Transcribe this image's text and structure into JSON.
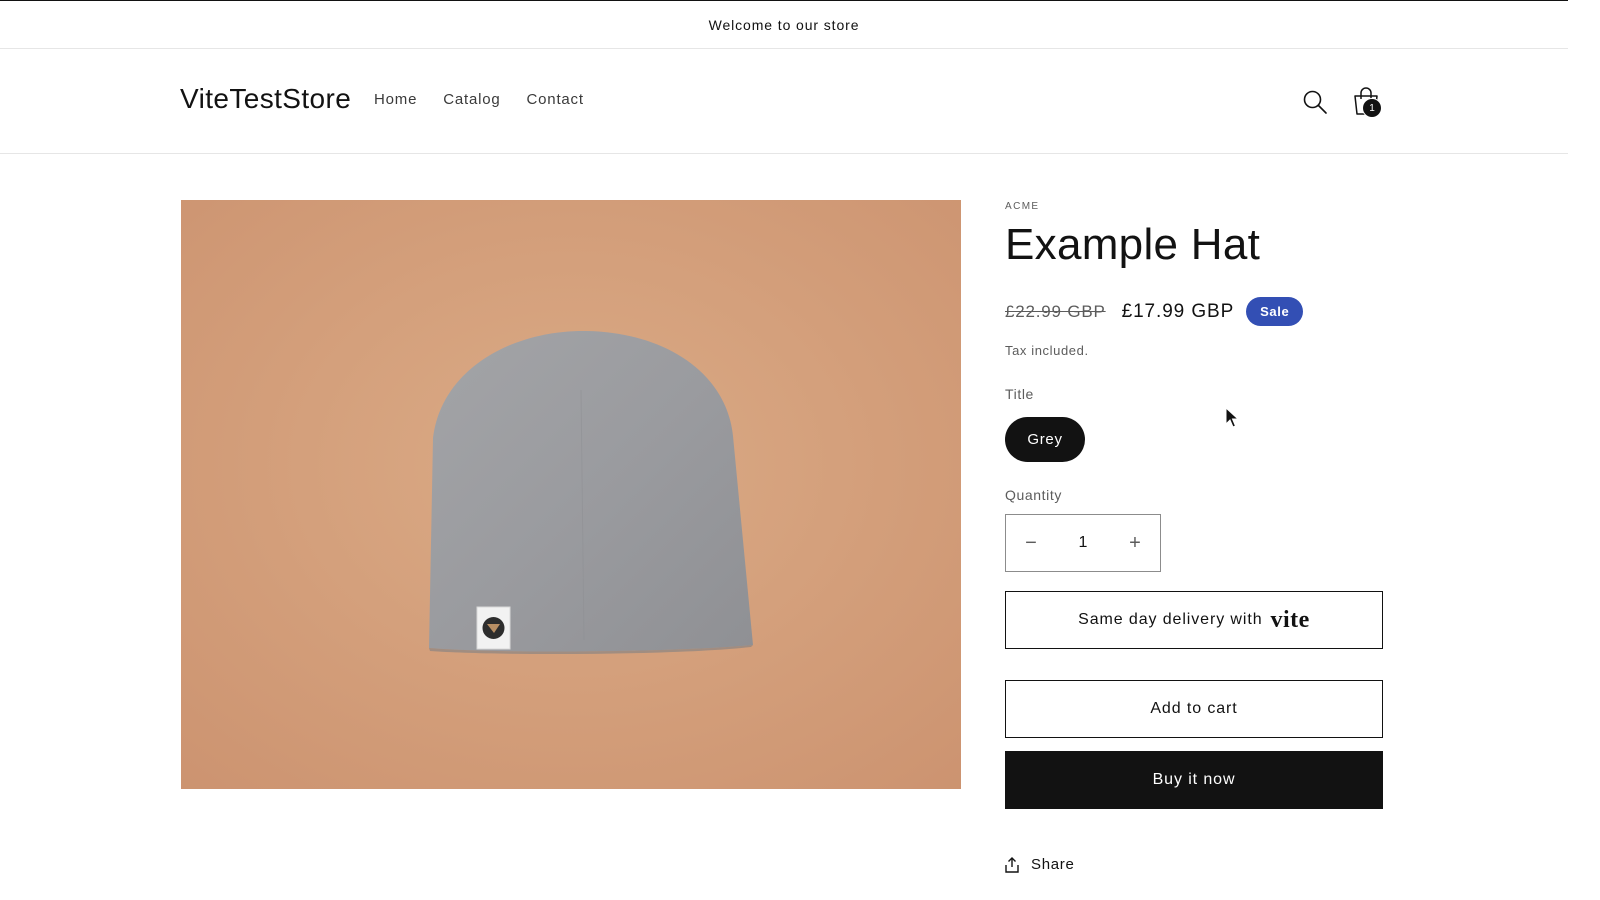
{
  "announcement": {
    "text": "Welcome to our store"
  },
  "header": {
    "logo": "ViteTestStore",
    "nav": [
      {
        "label": "Home"
      },
      {
        "label": "Catalog"
      },
      {
        "label": "Contact"
      }
    ],
    "icons": {
      "search": "search-icon",
      "cart": "shopping-bag-icon"
    },
    "cart_count": "1"
  },
  "product": {
    "vendor": "ACME",
    "title": "Example Hat",
    "price_regular": "£22.99 GBP",
    "price_sale": "£17.99 GBP",
    "badge": "Sale",
    "tax_note": "Tax included.",
    "option": {
      "label": "Title",
      "selected": "Grey"
    },
    "quantity": {
      "label": "Quantity",
      "value": "1",
      "minus": "−",
      "plus": "+"
    },
    "buttons": {
      "vite_text": "Same day delivery with",
      "vite_brand": "vite",
      "add_to_cart": "Add to cart",
      "buy_now": "Buy it now"
    },
    "share": "Share"
  },
  "colors": {
    "sale_badge": "#334fb4",
    "primary": "#121212",
    "background": "#ffffff"
  }
}
